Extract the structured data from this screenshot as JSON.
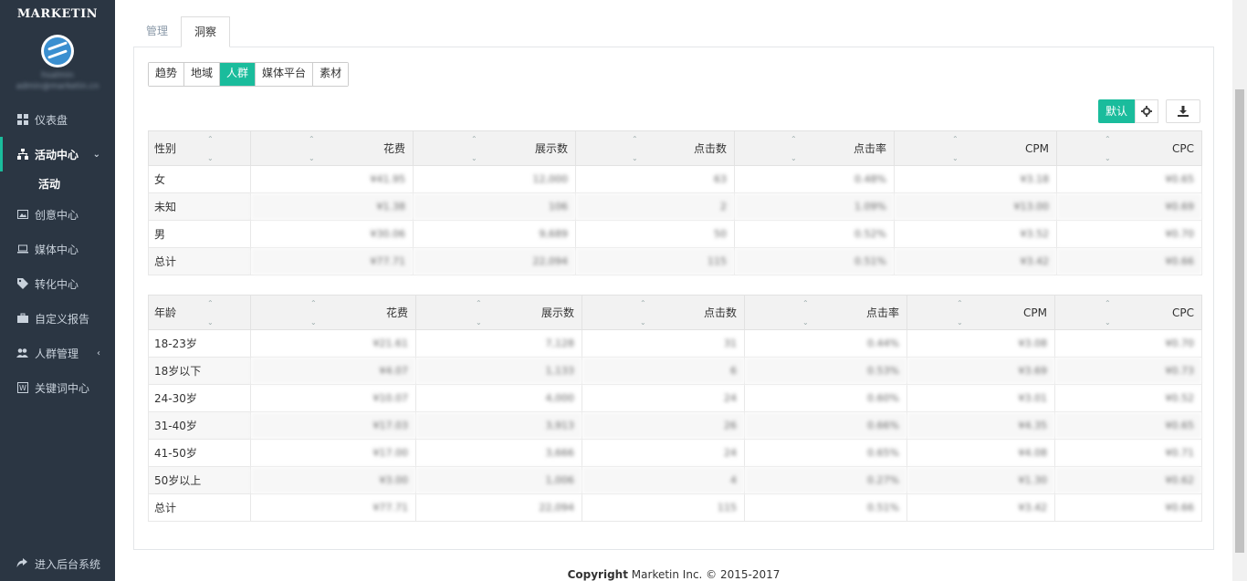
{
  "sidebar": {
    "brand": "MARKETIN",
    "user_name": "hsalmin",
    "user_email": "admin@marketin.cn",
    "items": [
      {
        "label": "仪表盘",
        "icon": "dashboard-icon"
      },
      {
        "label": "活动中心",
        "icon": "sitemap-icon"
      },
      {
        "label": "创意中心",
        "icon": "image-icon"
      },
      {
        "label": "媒体中心",
        "icon": "laptop-icon"
      },
      {
        "label": "转化中心",
        "icon": "tag-icon"
      },
      {
        "label": "自定义报告",
        "icon": "briefcase-icon"
      },
      {
        "label": "人群管理",
        "icon": "users-icon"
      },
      {
        "label": "关键词中心",
        "icon": "word-icon"
      }
    ],
    "sub_item": "活动",
    "bottom": "进入后台系统"
  },
  "tabs": {
    "manage": "管理",
    "insight": "洞察"
  },
  "subtabs": [
    "趋势",
    "地域",
    "人群",
    "媒体平台",
    "素材"
  ],
  "tools": {
    "default_label": "默认"
  },
  "gender_table": {
    "headers": [
      "性别",
      "花费",
      "展示数",
      "点击数",
      "点击率",
      "CPM",
      "CPC"
    ],
    "rows": [
      [
        "女",
        "¥41.95",
        "12,000",
        "63",
        "0.48%",
        "¥3.18",
        "¥0.65"
      ],
      [
        "未知",
        "¥1.38",
        "106",
        "2",
        "1.09%",
        "¥13.00",
        "¥0.69"
      ],
      [
        "男",
        "¥30.06",
        "9,689",
        "50",
        "0.52%",
        "¥3.52",
        "¥0.70"
      ],
      [
        "总计",
        "¥77.71",
        "22,094",
        "115",
        "0.51%",
        "¥3.42",
        "¥0.66"
      ]
    ]
  },
  "age_table": {
    "headers": [
      "年龄",
      "花费",
      "展示数",
      "点击数",
      "点击率",
      "CPM",
      "CPC"
    ],
    "rows": [
      [
        "18-23岁",
        "¥21.61",
        "7,128",
        "31",
        "0.44%",
        "¥3.08",
        "¥0.70"
      ],
      [
        "18岁以下",
        "¥4.07",
        "1,133",
        "6",
        "0.53%",
        "¥3.69",
        "¥0.73"
      ],
      [
        "24-30岁",
        "¥10.07",
        "4,000",
        "24",
        "0.60%",
        "¥3.01",
        "¥0.52"
      ],
      [
        "31-40岁",
        "¥17.03",
        "3,913",
        "26",
        "0.66%",
        "¥4.35",
        "¥0.65"
      ],
      [
        "41-50岁",
        "¥17.00",
        "3,666",
        "24",
        "0.65%",
        "¥4.08",
        "¥0.71"
      ],
      [
        "50岁以上",
        "¥3.00",
        "1,006",
        "4",
        "0.27%",
        "¥1.30",
        "¥0.62"
      ],
      [
        "总计",
        "¥77.71",
        "22,094",
        "115",
        "0.51%",
        "¥3.42",
        "¥0.66"
      ]
    ]
  },
  "footer": {
    "copyright": "Copyright",
    "text": "Marketin Inc. © 2015-2017"
  }
}
